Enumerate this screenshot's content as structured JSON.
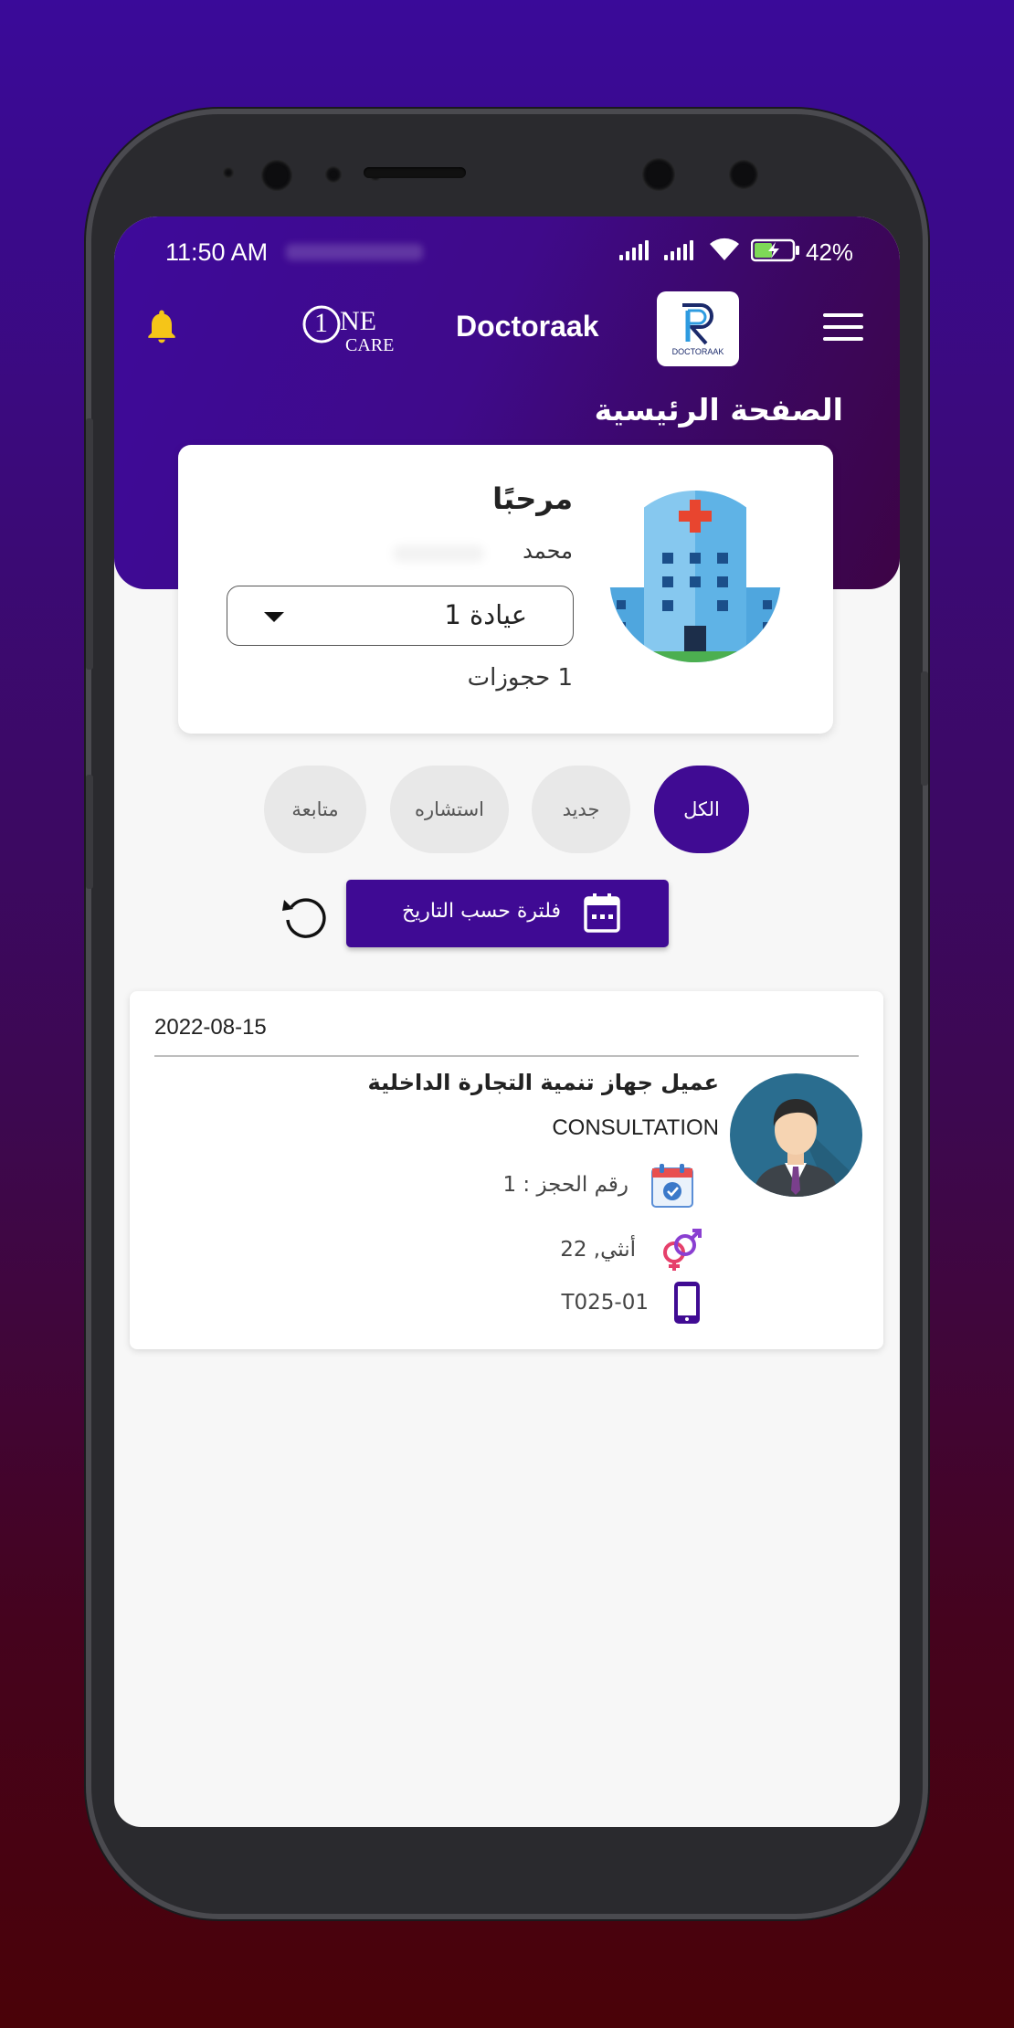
{
  "status_bar": {
    "time": "11:50 AM",
    "battery": "42%"
  },
  "app_bar": {
    "brand": "Doctoraak",
    "logo_sub": "DOCTORAAK",
    "onecare_big": "1",
    "onecare_ne": "NE",
    "onecare_care": "CARE"
  },
  "page": {
    "title": "الصفحة الرئيسية"
  },
  "welcome_card": {
    "greeting": "مرحبًا",
    "user_name": "محمد",
    "clinic_selected": "عيادة 1",
    "bookings_count": "1 حجوزات"
  },
  "filter_chips": [
    {
      "label": "الكل",
      "active": true
    },
    {
      "label": "جديد",
      "active": false
    },
    {
      "label": "استشاره",
      "active": false
    },
    {
      "label": "متابعة",
      "active": false
    }
  ],
  "date_filter": {
    "label": "فلترة حسب التاريخ"
  },
  "booking": {
    "date": "2022-08-15",
    "client_name": "عميل جهاز تنمية التجارة الداخلية",
    "type": "CONSULTATION",
    "booking_number": "رقم الحجز : 1",
    "gender_age": "أنثي, 22",
    "phone": "T025-01"
  },
  "colors": {
    "primary": "#400b93",
    "bell": "#f5c518",
    "chip_inactive": "#e8e8e8"
  }
}
